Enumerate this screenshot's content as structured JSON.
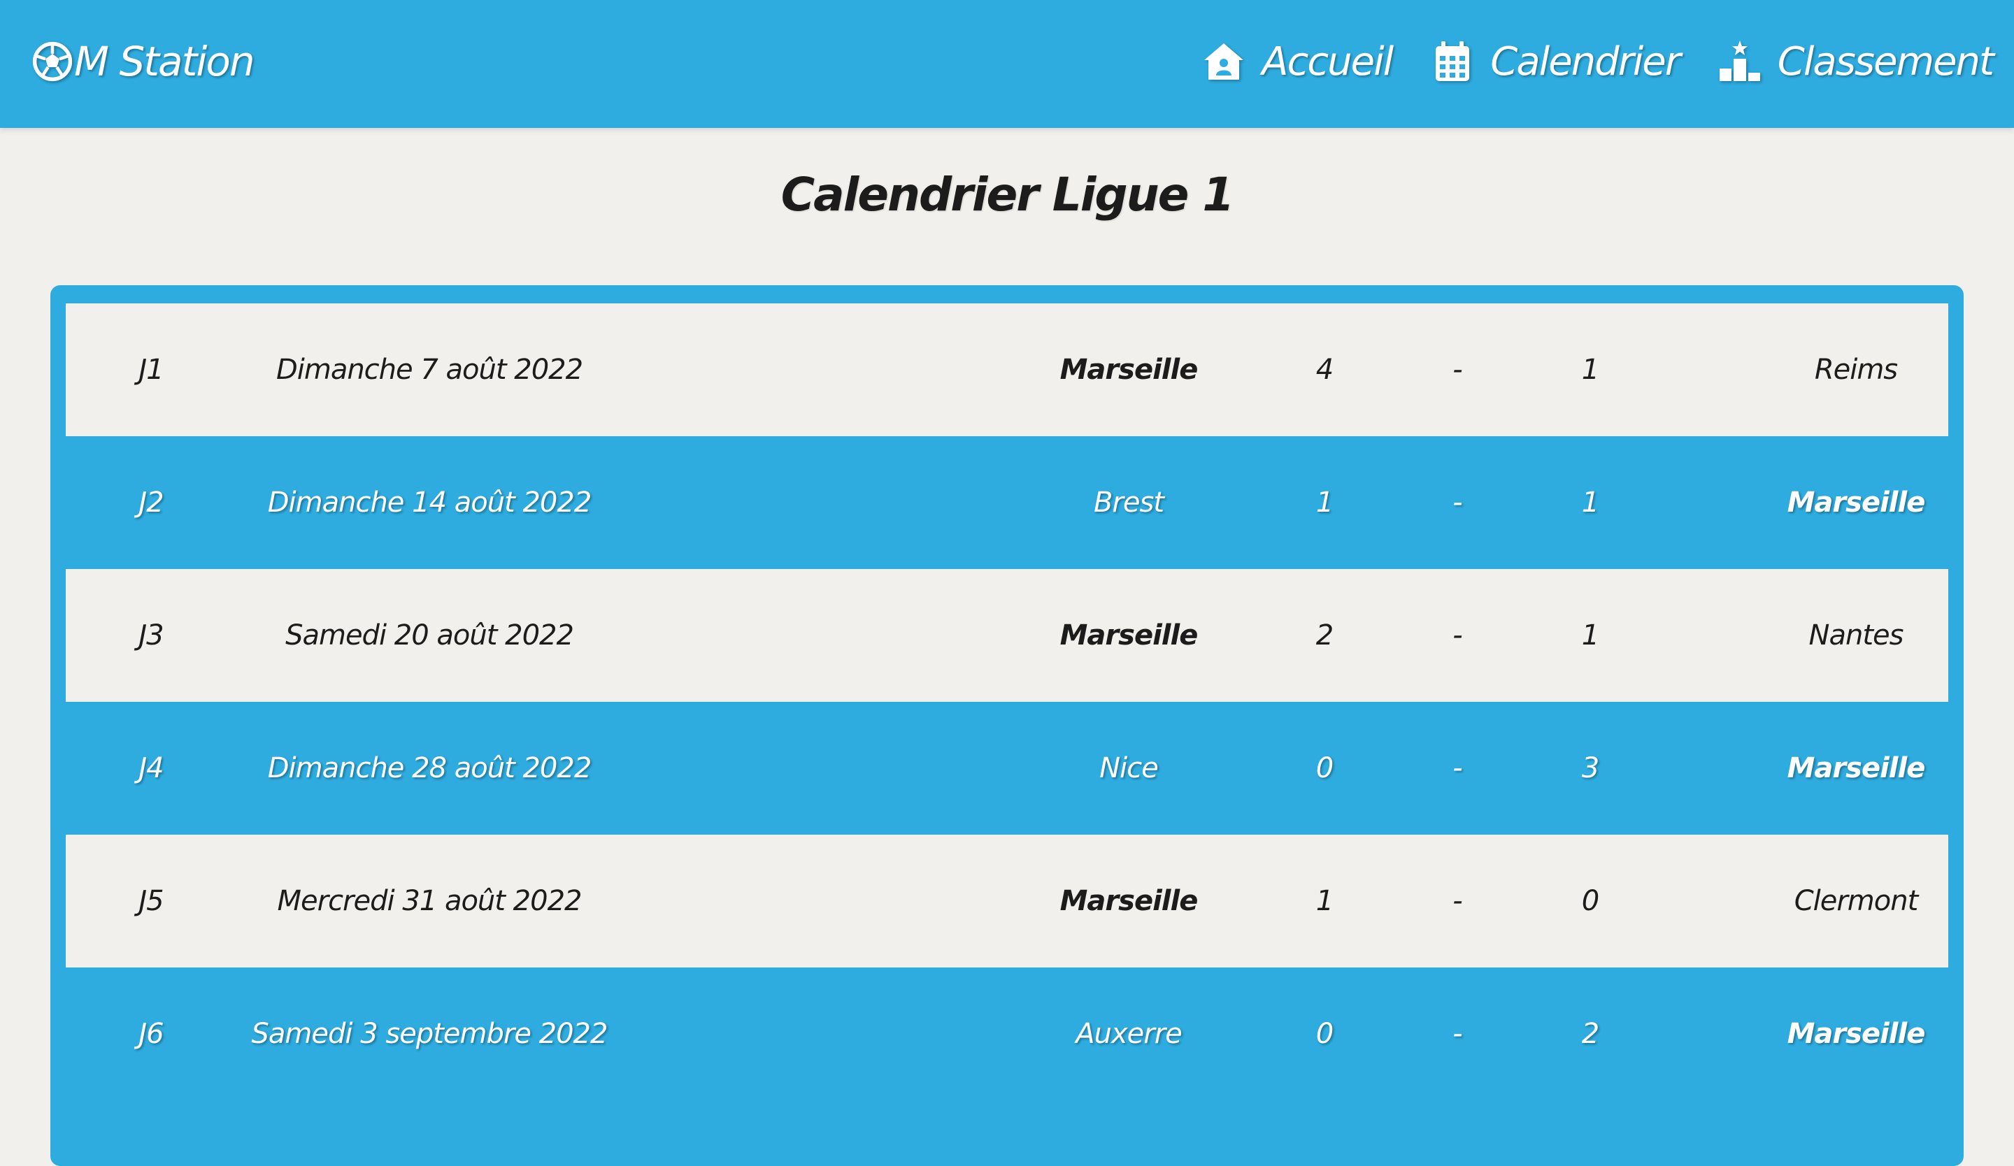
{
  "brand": {
    "name": "M Station",
    "icon": "soccer-ball-icon"
  },
  "nav": [
    {
      "label": "Accueil",
      "icon": "home-icon"
    },
    {
      "label": "Calendrier",
      "icon": "calendar-icon"
    },
    {
      "label": "Classement",
      "icon": "podium-icon"
    }
  ],
  "page_title": "Calendrier Ligue 1",
  "colors": {
    "primary": "#2eace0",
    "background": "#f2f0ec",
    "text": "#1c1c1c"
  },
  "matches": [
    {
      "round": "J1",
      "date": "Dimanche 7 août 2022",
      "home": "Marseille",
      "home_score": "4",
      "separator": "-",
      "away_score": "1",
      "away": "Reims",
      "marseille_side": "home"
    },
    {
      "round": "J2",
      "date": "Dimanche 14 août 2022",
      "home": "Brest",
      "home_score": "1",
      "separator": "-",
      "away_score": "1",
      "away": "Marseille",
      "marseille_side": "away"
    },
    {
      "round": "J3",
      "date": "Samedi 20 août 2022",
      "home": "Marseille",
      "home_score": "2",
      "separator": "-",
      "away_score": "1",
      "away": "Nantes",
      "marseille_side": "home"
    },
    {
      "round": "J4",
      "date": "Dimanche 28 août 2022",
      "home": "Nice",
      "home_score": "0",
      "separator": "-",
      "away_score": "3",
      "away": "Marseille",
      "marseille_side": "away"
    },
    {
      "round": "J5",
      "date": "Mercredi 31 août 2022",
      "home": "Marseille",
      "home_score": "1",
      "separator": "-",
      "away_score": "0",
      "away": "Clermont",
      "marseille_side": "home"
    },
    {
      "round": "J6",
      "date": "Samedi 3 septembre 2022",
      "home": "Auxerre",
      "home_score": "0",
      "separator": "-",
      "away_score": "2",
      "away": "Marseille",
      "marseille_side": "away"
    }
  ]
}
